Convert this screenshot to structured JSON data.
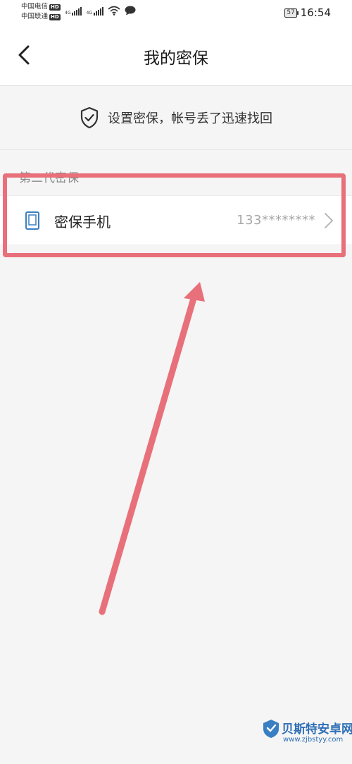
{
  "status_bar": {
    "carrier1": "中国电信",
    "carrier2": "中国联通",
    "hd_badge": "HD",
    "network1": "4G",
    "network2": "4G",
    "battery": "57",
    "time": "16:54"
  },
  "header": {
    "title": "我的密保"
  },
  "banner": {
    "text": "设置密保，帐号丢了迅速找回"
  },
  "section": {
    "label": "第二代密保"
  },
  "row": {
    "label": "密保手机",
    "value": "133********"
  },
  "watermark": {
    "brand": "贝斯特安卓网",
    "url": "www.zjbstyy.com"
  },
  "colors": {
    "annotation": "#e8707a",
    "accent_icon": "#3a7fc1",
    "watermark": "#2e6fb6"
  },
  "icons": [
    "back-arrow-icon",
    "shield-check-icon",
    "phone-icon",
    "chevron-right-icon",
    "wifi-icon",
    "message-icon"
  ]
}
